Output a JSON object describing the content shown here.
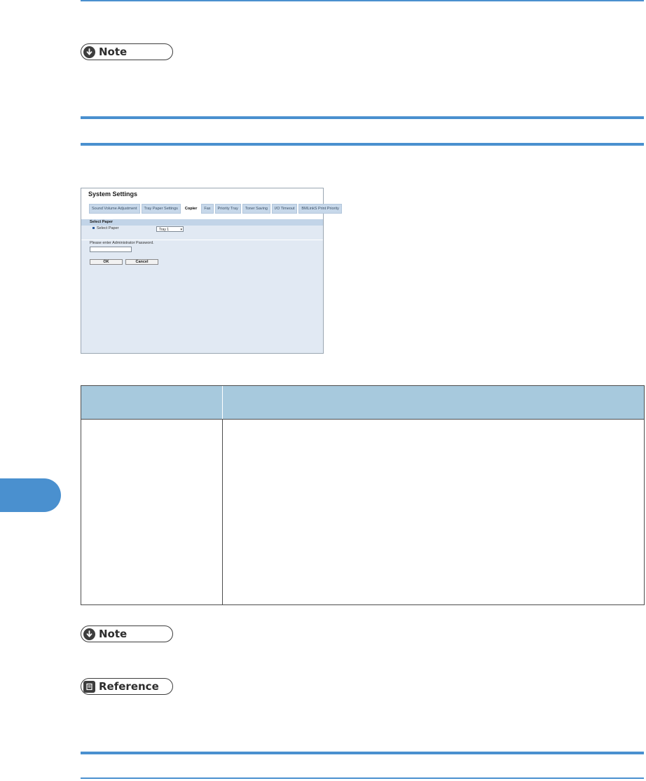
{
  "note_badge_1": {
    "label": "Note"
  },
  "note_badge_2": {
    "label": "Note"
  },
  "reference_badge": {
    "label": "Reference"
  },
  "screenshot": {
    "title": "System Settings",
    "tabs": [
      "Sound Volume Adjustment",
      "Tray Paper Settings",
      "Copier",
      "Fax",
      "Priority Tray",
      "Toner Saving",
      "I/O Timeout",
      "BMLinkS Print Priority"
    ],
    "active_tab": "Copier",
    "section_label": "Select Paper",
    "field_label": "Select Paper",
    "select_value": "Tray 1",
    "password_prompt": "Please enter Administrator Password.",
    "ok_label": "OK",
    "cancel_label": "Cancel"
  },
  "colors": {
    "accent_rule": "#4a90cf",
    "table_header": "#a7c9dd",
    "screenshot_bg": "#e1e9f3"
  }
}
